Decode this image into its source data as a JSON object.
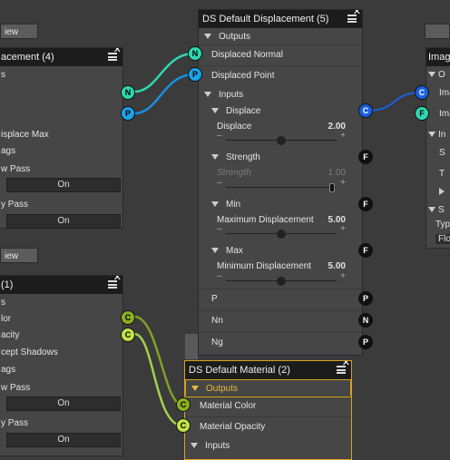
{
  "colors": {
    "normal_port": "#2ed7b1",
    "point_port": "#1aa3ea",
    "color_port": "#c1e14a",
    "color_port_dark": "#8ab020",
    "float_port": "#111111",
    "selection": "#d9a21c",
    "wire_cyan": "#2ed7b1",
    "wire_blue": "#1a8fe0",
    "wire_olive": "#7fa126",
    "wire_lime": "#a3d14a"
  },
  "left_top": {
    "view_button": "iew",
    "title": "acement (4)",
    "rows": [
      "s",
      "",
      "",
      "isplace Max",
      "ags",
      "w Pass",
      "On",
      "y Pass",
      "On"
    ]
  },
  "left_bottom": {
    "view_button": "iew",
    "title": " (1)",
    "rows": [
      "s",
      "lor",
      "acity",
      "cept Shadows",
      "ags",
      "w Pass",
      "On",
      "y Pass",
      "On"
    ]
  },
  "displacement_node": {
    "title": "DS Default Displacement (5)",
    "outputs_label": "Outputs",
    "outputs": [
      "Displaced Normal",
      "Displaced Point"
    ],
    "inputs_label": "Inputs",
    "groups": [
      {
        "name": "Displace",
        "param": "Displace",
        "value": "2.00",
        "fraction": 0.5,
        "disabled": false
      },
      {
        "name": "Strength",
        "param": "Strength",
        "value": "1.00",
        "fraction": 1.0,
        "disabled": true
      },
      {
        "name": "Min",
        "param": "Maximum Displacement",
        "value": "5.00",
        "fraction": 0.5,
        "disabled": false
      },
      {
        "name": "Max",
        "param": "Minimum Displacement",
        "value": "5.00",
        "fraction": 0.5,
        "disabled": false
      }
    ],
    "extra_inputs": [
      "P",
      "Nn",
      "Ng"
    ]
  },
  "material_node": {
    "title": "DS Default Material (2)",
    "outputs_label": "Outputs",
    "outputs": [
      "Material Color",
      "Material Opacity"
    ],
    "inputs_label": "Inputs"
  },
  "image_node": {
    "title": "Imag",
    "rows": [
      "O",
      "Ima",
      "Ima",
      "In",
      "S",
      "T",
      "",
      "S",
      "Typ",
      "Flo"
    ]
  },
  "port_letters": {
    "normal": "N",
    "point": "P",
    "color": "C",
    "float": "F"
  }
}
